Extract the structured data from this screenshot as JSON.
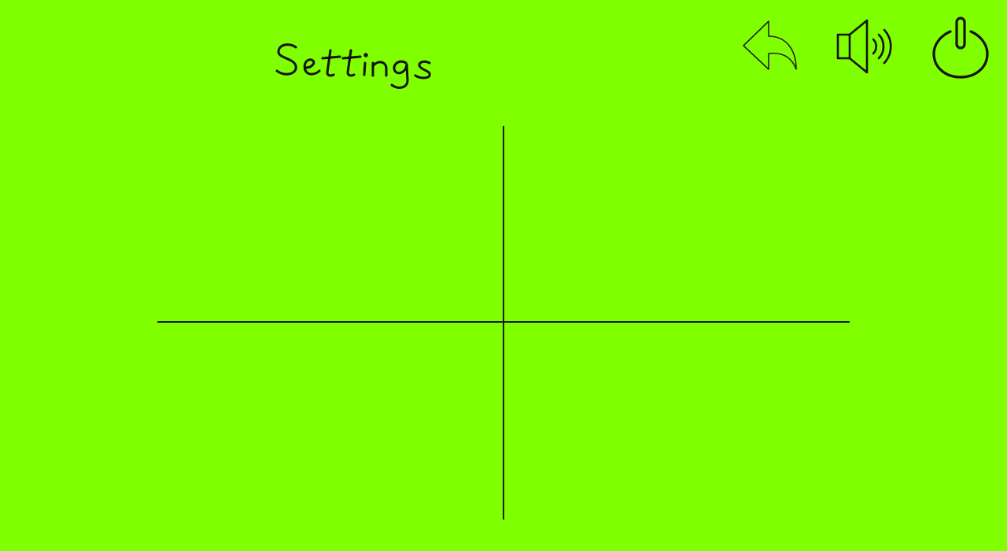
{
  "screen": {
    "title": "Settings",
    "background_color": "#7fff00",
    "ink_color": "#111111"
  },
  "toolbar": {
    "back_icon": "back-arrow-icon",
    "sound_icon": "speaker-icon",
    "power_icon": "power-icon"
  }
}
